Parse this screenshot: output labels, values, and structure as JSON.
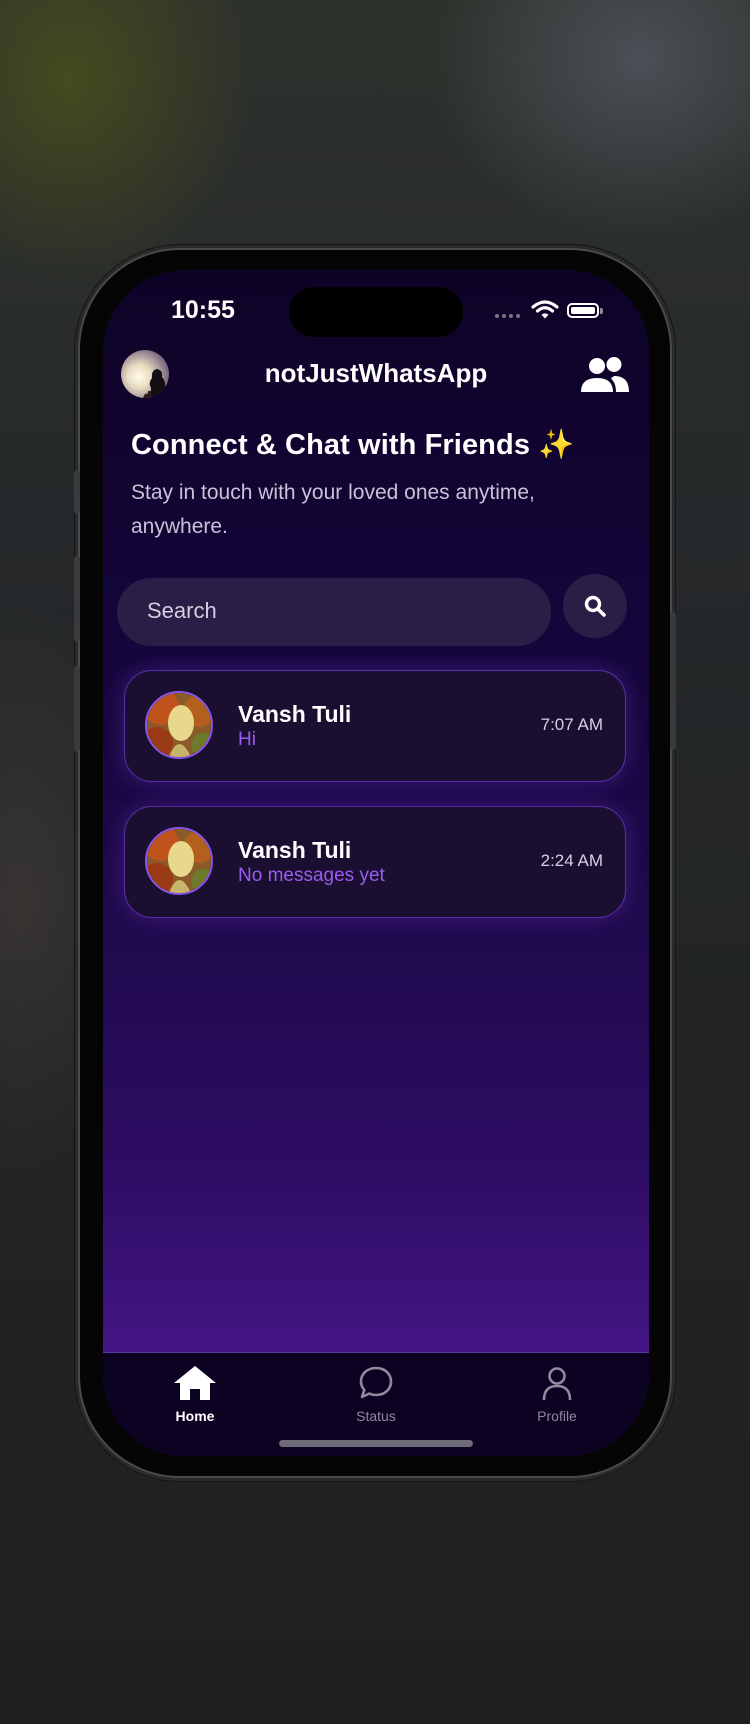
{
  "status_bar": {
    "time": "10:55"
  },
  "header": {
    "app_title": "notJustWhatsApp"
  },
  "hero": {
    "title": "Connect & Chat with Friends ✨",
    "subtitle": "Stay in touch with your loved ones anytime, anywhere."
  },
  "search": {
    "placeholder": "Search"
  },
  "chats": [
    {
      "name": "Vansh Tuli",
      "last_message": "Hi",
      "time": "7:07 AM"
    },
    {
      "name": "Vansh Tuli",
      "last_message": "No messages yet",
      "time": "2:24 AM"
    }
  ],
  "tabs": [
    {
      "label": "Home",
      "icon": "home-icon",
      "active": true
    },
    {
      "label": "Status",
      "icon": "chat-bubble-icon",
      "active": false
    },
    {
      "label": "Profile",
      "icon": "person-icon",
      "active": false
    }
  ],
  "colors": {
    "accent": "#9a5cf0",
    "card_border": "#5b2ea8",
    "background_top": "#0e0326",
    "background_bottom": "#52199a"
  }
}
